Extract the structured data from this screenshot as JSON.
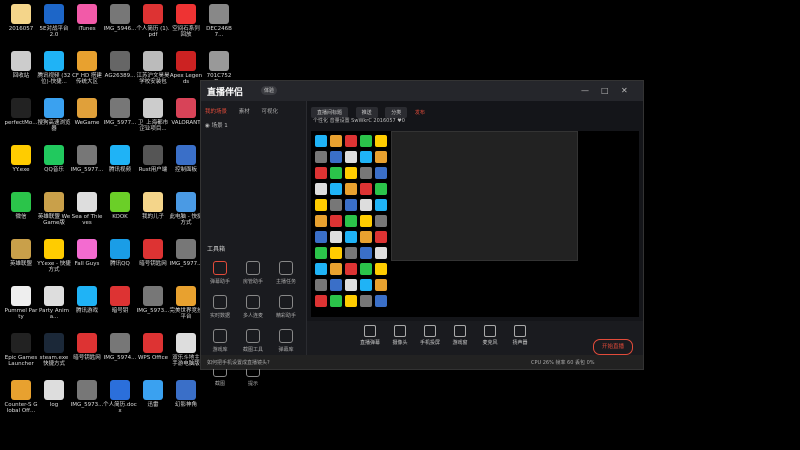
{
  "desktop_icons": [
    {
      "label": "2016057",
      "color": "#f4d58a"
    },
    {
      "label": "5E对战平台 2.0",
      "color": "#1d66c8"
    },
    {
      "label": "iTunes",
      "color": "#f25aa8"
    },
    {
      "label": "IMG_5946...",
      "color": "#777"
    },
    {
      "label": "个人简历 (1).pdf",
      "color": "#d33"
    },
    {
      "label": "空间石系列 回放",
      "color": "#e33"
    },
    {
      "label": "DEC246B7...",
      "color": "#888"
    },
    {
      "label": "回收站",
      "color": "#ccc"
    },
    {
      "label": "腾讯视频 (32位)-快捷...",
      "color": "#1fb3f6"
    },
    {
      "label": "CF HD 搭建 传统大区",
      "color": "#e8a12f"
    },
    {
      "label": "AG26389...",
      "color": "#666"
    },
    {
      "label": "江苏沪文昊昊 学校安装包",
      "color": "#bbb"
    },
    {
      "label": "Apex Legends",
      "color": "#c22"
    },
    {
      "label": "701C752D...",
      "color": "#999"
    },
    {
      "label": "perfectMo...",
      "color": "#222"
    },
    {
      "label": "搜狗高速浏览器",
      "color": "#3aa1f0"
    },
    {
      "label": "WeGame",
      "color": "#e0a03a"
    },
    {
      "label": "IMG_5977...",
      "color": "#777"
    },
    {
      "label": "卫_上海都市 企业项目...",
      "color": "#ccc"
    },
    {
      "label": "VALORANT",
      "color": "#d84358"
    },
    {
      "label": "Microsoft Edge",
      "color": "#1d8fdc"
    },
    {
      "label": "YY.exe",
      "color": "#ffcc00"
    },
    {
      "label": "QQ音乐",
      "color": "#21c95e"
    },
    {
      "label": "IMG_5977...",
      "color": "#777"
    },
    {
      "label": "腾讯视频",
      "color": "#1fb3f6"
    },
    {
      "label": "Rust用户端",
      "color": "#555"
    },
    {
      "label": "控制面板",
      "color": "#3a6fc8"
    },
    {
      "label": "网易UU加速器",
      "color": "#2b6fdb"
    },
    {
      "label": "微信",
      "color": "#2bc44a"
    },
    {
      "label": "英雄联盟 WeGame版",
      "color": "#c9a04a"
    },
    {
      "label": "Sea of Thieves",
      "color": "#ddd"
    },
    {
      "label": "KOOK",
      "color": "#6bcf28"
    },
    {
      "label": "我的儿子",
      "color": "#f4d58a"
    },
    {
      "label": "此电脑 - 快捷方式",
      "color": "#4a9ae4"
    },
    {
      "label": "IMG_5978...",
      "color": "#777"
    },
    {
      "label": "英雄联盟",
      "color": "#c9a04a"
    },
    {
      "label": "YY.exe - 快捷方式",
      "color": "#ffcc00"
    },
    {
      "label": "Fall Guys",
      "color": "#f36bd0"
    },
    {
      "label": "腾讯QQ",
      "color": "#1a9de6"
    },
    {
      "label": "暗号钥匙网",
      "color": "#d33"
    },
    {
      "label": "IMG_5977...",
      "color": "#777"
    },
    {
      "label": "斗鱼直播伴侣",
      "color": "#f77b21"
    },
    {
      "label": "Pummel Party",
      "color": "#eee"
    },
    {
      "label": "Party Anima...",
      "color": "#ddd"
    },
    {
      "label": "腾讯游戏",
      "color": "#1fb3f6"
    },
    {
      "label": "暗号钥",
      "color": "#d33"
    },
    {
      "label": "IMG_5973...",
      "color": "#777"
    },
    {
      "label": "完美世界竞技平台",
      "color": "#e8a12f"
    },
    {
      "label": "QQ游戏",
      "color": "#3aa1f0"
    },
    {
      "label": "Epic Games Launcher",
      "color": "#222"
    },
    {
      "label": "steam.exe 快捷方式",
      "color": "#1b2838"
    },
    {
      "label": "暗号钥匙网",
      "color": "#d33"
    },
    {
      "label": "IMG_5974...",
      "color": "#777"
    },
    {
      "label": "WPS Office",
      "color": "#d33"
    },
    {
      "label": "双乐斗地主 手游电脑版",
      "color": "#ddd"
    },
    {
      "label": "Cube Racer",
      "color": "#c22"
    },
    {
      "label": "Counter-S Global Off...",
      "color": "#e8a12f"
    },
    {
      "label": "log",
      "color": "#ddd"
    },
    {
      "label": "IMG_5973...",
      "color": "#777"
    },
    {
      "label": "个人简历.docx",
      "color": "#2b6fdb"
    },
    {
      "label": "迅雷",
      "color": "#3aa1f0"
    },
    {
      "label": "幻影神角",
      "color": "#3a6fc8"
    }
  ],
  "app": {
    "brand": "直播伴侣",
    "badge": "体验",
    "window_controls": [
      "—",
      "□",
      "✕"
    ],
    "sidebar_tabs": [
      "我的场景",
      "素材",
      "可视化"
    ],
    "scene": "场景 1",
    "tools_header": "工具箱",
    "tools": [
      "弹幕助手",
      "房管助手",
      "主播任务",
      "实时数据",
      "多人连麦",
      "精彩助手",
      "游戏库",
      "截图工具",
      "弹幕库",
      "截图",
      "提示"
    ],
    "top_fields": [
      "直播间标题",
      "推送",
      "分类",
      "发布"
    ],
    "subbar": "个性化 音量设置  SwWkrC  2016057  ♥0",
    "bottom_buttons": [
      "直播弹幕",
      "摄像头",
      "手机投屏",
      "游戏窗",
      "麦克风",
      "扬声器"
    ],
    "go_live": "开始直播",
    "status_left": "如何把手机设置成直播镜头?",
    "status_right": "CPU 26%  帧率 60  丢包 0%"
  }
}
